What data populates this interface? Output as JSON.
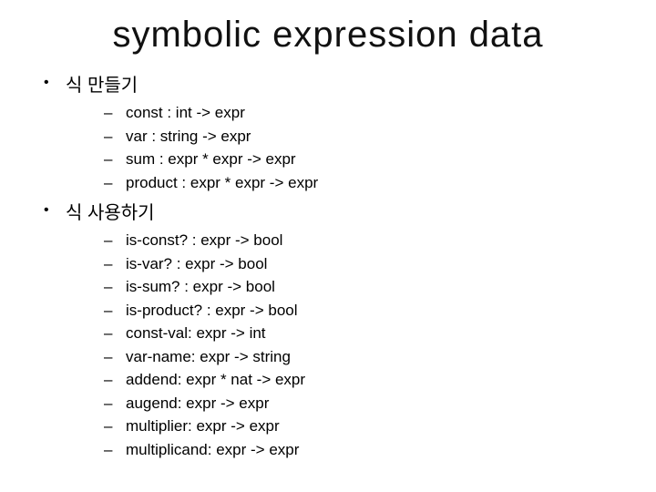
{
  "title": "symbolic expression data",
  "sections": [
    {
      "heading": "식 만들기",
      "items": [
        "const : int -> expr",
        "var : string -> expr",
        "sum : expr * expr -> expr",
        "product : expr * expr -> expr"
      ]
    },
    {
      "heading": "식 사용하기",
      "items": [
        "is-const? : expr -> bool",
        "is-var? : expr -> bool",
        "is-sum? : expr -> bool",
        "is-product? : expr -> bool",
        "const-val: expr -> int",
        "var-name: expr -> string",
        "addend: expr * nat -> expr",
        "augend: expr -> expr",
        "multiplier: expr -> expr",
        "multiplicand: expr -> expr"
      ]
    }
  ]
}
